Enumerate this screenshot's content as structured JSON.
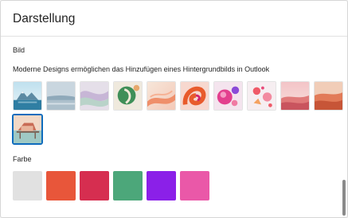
{
  "dialog": {
    "title": "Darstellung"
  },
  "image_section": {
    "label": "Bild",
    "description": "Moderne Designs ermöglichen das Hinzufügen eines Hintergrundbilds in Outlook",
    "selected_index": 10,
    "thumbnails": [
      {
        "name": "thumb-iceberg-lake"
      },
      {
        "name": "thumb-misty-water"
      },
      {
        "name": "thumb-pastel-waves"
      },
      {
        "name": "thumb-green-circle"
      },
      {
        "name": "thumb-sunset-ribbons"
      },
      {
        "name": "thumb-orange-swirl"
      },
      {
        "name": "thumb-pink-spheres"
      },
      {
        "name": "thumb-floating-shapes"
      },
      {
        "name": "thumb-pink-desert"
      },
      {
        "name": "thumb-orange-dunes"
      },
      {
        "name": "thumb-pier-house"
      }
    ]
  },
  "color_section": {
    "label": "Farbe",
    "swatches": [
      {
        "name": "swatch-gray",
        "color": "#e1e1e1"
      },
      {
        "name": "swatch-orange",
        "color": "#e8563a"
      },
      {
        "name": "swatch-crimson",
        "color": "#d62e50"
      },
      {
        "name": "swatch-green",
        "color": "#4ca77a"
      },
      {
        "name": "swatch-purple",
        "color": "#8b20e8"
      },
      {
        "name": "swatch-pink",
        "color": "#ea58a8"
      }
    ]
  },
  "colors": {
    "accent": "#0f6cbd"
  }
}
